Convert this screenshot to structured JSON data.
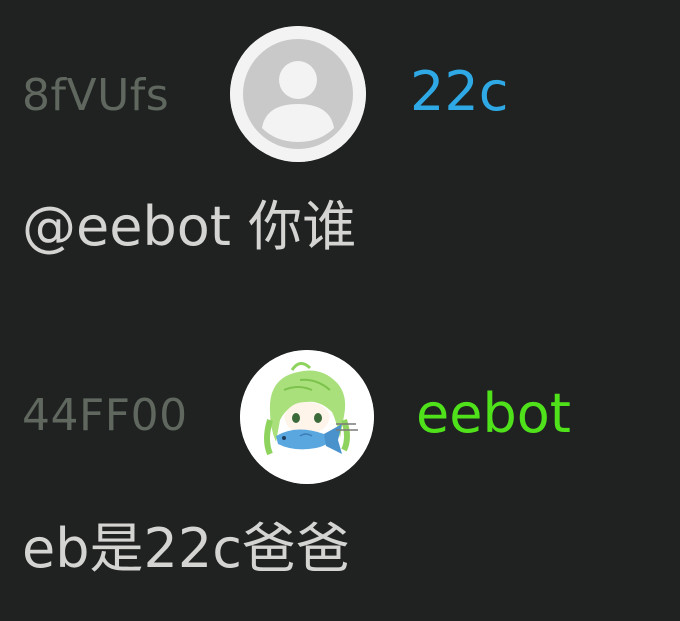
{
  "messages": [
    {
      "user_id": "8fVUfs",
      "username": "22c",
      "username_color": "#2ea9e6",
      "avatar": "default-user-avatar",
      "text": "@eebot 你谁"
    },
    {
      "user_id": "44FF00",
      "username": "eebot",
      "username_color": "#4fe21b",
      "avatar": "anime-girl-fish-avatar",
      "text": "eb是22c爸爸"
    }
  ]
}
